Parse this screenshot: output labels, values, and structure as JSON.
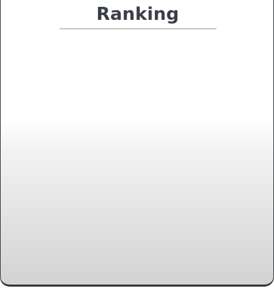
{
  "panel": {
    "title": "Ranking"
  },
  "ranking": {
    "entries": []
  }
}
